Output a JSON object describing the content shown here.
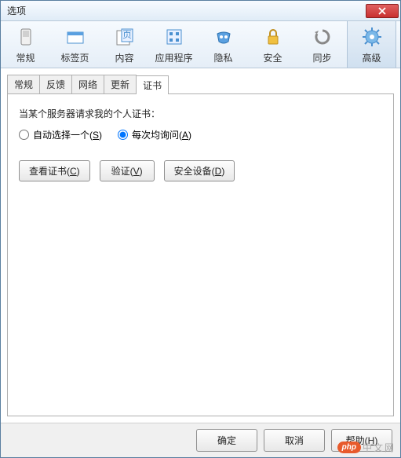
{
  "window": {
    "title": "选项"
  },
  "toolbar": [
    {
      "id": "general",
      "label": "常规"
    },
    {
      "id": "tabs",
      "label": "标签页"
    },
    {
      "id": "content",
      "label": "内容"
    },
    {
      "id": "apps",
      "label": "应用程序"
    },
    {
      "id": "privacy",
      "label": "隐私"
    },
    {
      "id": "security",
      "label": "安全"
    },
    {
      "id": "sync",
      "label": "同步"
    },
    {
      "id": "advanced",
      "label": "高级",
      "active": true
    }
  ],
  "tabs": [
    {
      "label": "常规"
    },
    {
      "label": "反馈"
    },
    {
      "label": "网络"
    },
    {
      "label": "更新"
    },
    {
      "label": "证书",
      "active": true
    }
  ],
  "panel": {
    "desc": "当某个服务器请求我的个人证书：",
    "radios": {
      "auto_pre": "自动选择一个(",
      "auto_u": "S",
      "auto_post": ")",
      "ask_pre": "每次均询问(",
      "ask_u": "A",
      "ask_post": ")"
    },
    "buttons": {
      "view_pre": "查看证书(",
      "view_u": "C",
      "view_post": ")",
      "verify_pre": "验证(",
      "verify_u": "V",
      "verify_post": ")",
      "devices_pre": "安全设备(",
      "devices_u": "D",
      "devices_post": ")"
    }
  },
  "footer": {
    "ok": "确定",
    "cancel": "取消",
    "help_pre": "帮助(",
    "help_u": "H",
    "help_post": ")"
  },
  "watermark": {
    "badge": "php",
    "text": "中文网"
  }
}
